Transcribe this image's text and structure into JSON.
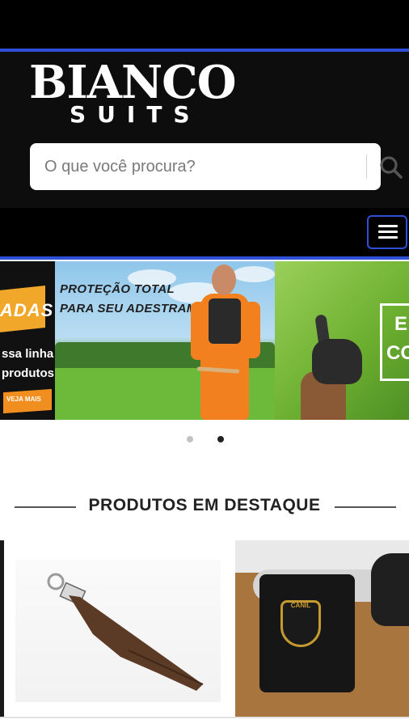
{
  "header": {
    "logo_main": "BIANCO",
    "logo_sub": "SUITS"
  },
  "search": {
    "placeholder": "O que você procura?",
    "button_icon": "search-icon"
  },
  "nav": {
    "menu_icon": "hamburger-menu-icon"
  },
  "banner": {
    "prev_slide": {
      "promo_text": "ADAS",
      "line1": "ssa linha",
      "line2": "produtos",
      "button_label": "VEJA MAIS"
    },
    "main_slide": {
      "caption_line1": "PROTEÇÃO TOTAL",
      "caption_line2": "PARA SEU ADESTRAMENTO"
    },
    "next_slide": {
      "text_line1": "E",
      "text_line2": "CO"
    },
    "dots": [
      {
        "active": false
      },
      {
        "active": true
      }
    ]
  },
  "featured": {
    "title": "PRODUTOS EM DESTAQUE",
    "products": [
      {
        "name": "brown-leather-tug-icon"
      },
      {
        "name": "dog-harness-icon",
        "badge_text": "CANIL"
      }
    ]
  },
  "colors": {
    "accent_blue": "#2f4fd6",
    "header_bg": "#0d0d0d",
    "orange_suit": "#f2801f"
  }
}
